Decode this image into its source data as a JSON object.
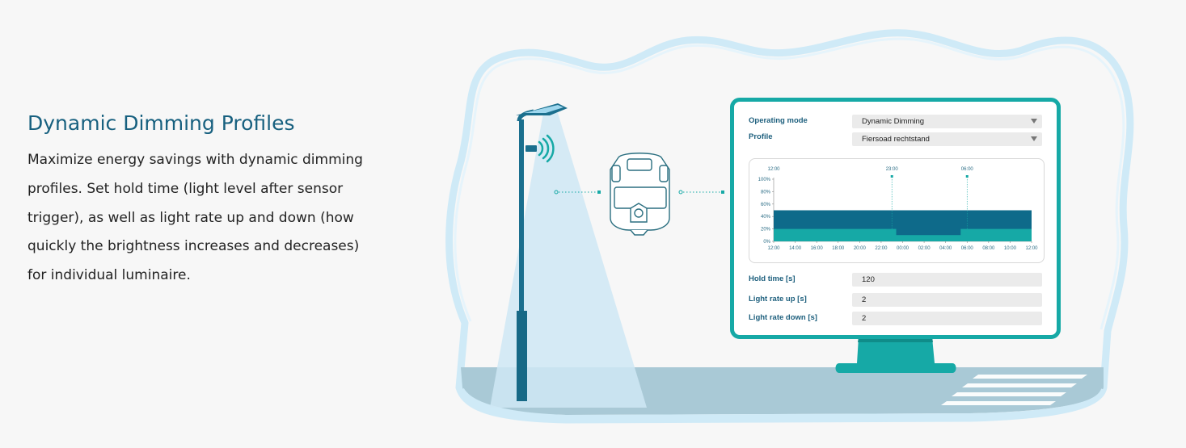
{
  "heading": "Dynamic Dimming Profiles",
  "description": "Maximize energy savings with dynamic dimming profiles. Set hold time (light level after sensor trigger), as well as light rate up and down (how quickly the brightness increases and decreases) for individual luminaire.",
  "monitor": {
    "operating_mode": {
      "label": "Operating mode",
      "value": "Dynamic Dimming"
    },
    "profile": {
      "label": "Profile",
      "value": "Fiersoad rechtstand"
    },
    "hold_time": {
      "label": "Hold time [s]",
      "value": "120"
    },
    "rate_up": {
      "label": "Light rate up [s]",
      "value": "2"
    },
    "rate_down": {
      "label": "Light rate down [s]",
      "value": "2"
    }
  },
  "colors": {
    "brand_teal": "#16a9a6",
    "dark_blue": "#0e6a8a",
    "light_blue_outline": "#cfeaf7",
    "title_blue": "#17607f"
  },
  "chart_data": {
    "type": "area",
    "top_markers": [
      "12:00",
      "23:00",
      "06:00"
    ],
    "x": [
      "12:00",
      "14:00",
      "16:00",
      "18:00",
      "20:00",
      "22:00",
      "00:00",
      "02:00",
      "04:00",
      "06:00",
      "08:00",
      "10:00",
      "12:00"
    ],
    "y_ticks": [
      "100%",
      "80%",
      "60%",
      "40%",
      "20%",
      "0%"
    ],
    "ylim": [
      0,
      100
    ],
    "series": [
      {
        "values": [
          50,
          50,
          50,
          50,
          50,
          50,
          50,
          50,
          50,
          50,
          50,
          50,
          50
        ]
      },
      {
        "values": [
          20,
          20,
          20,
          20,
          20,
          20,
          10,
          10,
          10,
          20,
          20,
          20,
          20
        ]
      }
    ]
  }
}
